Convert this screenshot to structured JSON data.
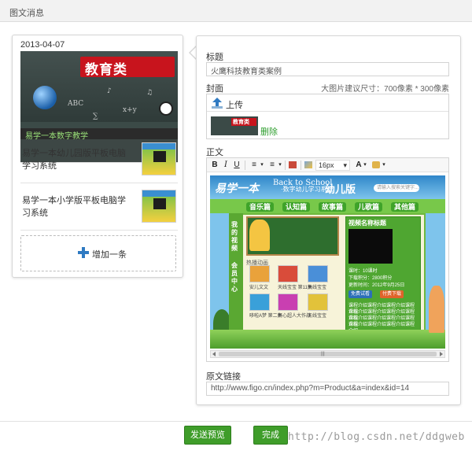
{
  "header": {
    "title": "图文消息"
  },
  "preview": {
    "date": "2013-04-07",
    "cover": {
      "ribbon_text": "教育类",
      "strip_text": "易学一本数字教学",
      "chalk": [
        "ABC",
        "♪",
        "x+y",
        "∑",
        "♫"
      ]
    },
    "items": [
      {
        "title": "易学一本幼儿园版平板电脑学习系统"
      },
      {
        "title": "易学一本小学版平板电脑学习系统"
      }
    ],
    "add_label": "增加一条"
  },
  "form": {
    "title_label": "标题",
    "title_value": "火鹰科技教育类案例",
    "cover_label": "封面",
    "cover_hint": "大图片建议尺寸：700像素 * 300像素",
    "upload_label": "上传",
    "cover_thumb_text": "教育类",
    "delete_label": "删除",
    "body_label": "正文",
    "toolbar": {
      "bold": "B",
      "italic": "I",
      "underline": "U",
      "font_size": "16px",
      "font_color": "A",
      "list_ordered": "≡",
      "list_bullet": "≡"
    },
    "content": {
      "logo": "易学一本",
      "logo_sub": "·数字幼儿学习系统",
      "edition": "幼儿版",
      "search_placeholder": "请输入搜索关键字...",
      "tabs": [
        "音乐篇",
        "认知篇",
        "故事篇",
        "儿歌篇",
        "其他篇"
      ],
      "side_labels": [
        "我的视频",
        "会员中心"
      ],
      "banner_text": "Back to School",
      "hot_label": "热播动画",
      "cards": [
        {
          "caption": "安儿文文",
          "color": "#e9a23b"
        },
        {
          "caption": "天线宝宝 第11集",
          "color": "#d94c3a"
        },
        {
          "caption": "天线宝宝",
          "color": "#4a8fd8"
        },
        {
          "caption": "哆啦A梦 第二集",
          "color": "#3aa0d9"
        },
        {
          "caption": "开心超人大作战",
          "color": "#c93fb1"
        },
        {
          "caption": "天线宝宝",
          "color": "#e2c23a"
        }
      ],
      "video_title": "视频名称标题",
      "info_lines": [
        "课时：10课时",
        "下载积分：2800积分",
        "更新时间：2012年9月25日"
      ],
      "play_button": "免费试看",
      "download_button": "付费下载",
      "desc_lines": [
        "课程介绍课程介绍课程介绍课程介绍",
        "课程介绍课程介绍课程介绍课程介绍",
        "课程介绍课程介绍课程介绍课程介绍",
        "课程介绍课程介绍课程介绍课程介绍"
      ]
    },
    "link_label": "原文链接",
    "link_value": "http://www.figo.cn/index.php?m=Product&a=index&id=14"
  },
  "footer": {
    "preview_button": "发送预览",
    "finish_button": "完成",
    "watermark": "http://blog.csdn.net/ddgweb"
  },
  "colors": {
    "accent_green": "#3f9d2a",
    "link_green": "#2e9e2e",
    "ribbon_red": "#c8141d",
    "icon_blue": "#2f7ac2"
  }
}
